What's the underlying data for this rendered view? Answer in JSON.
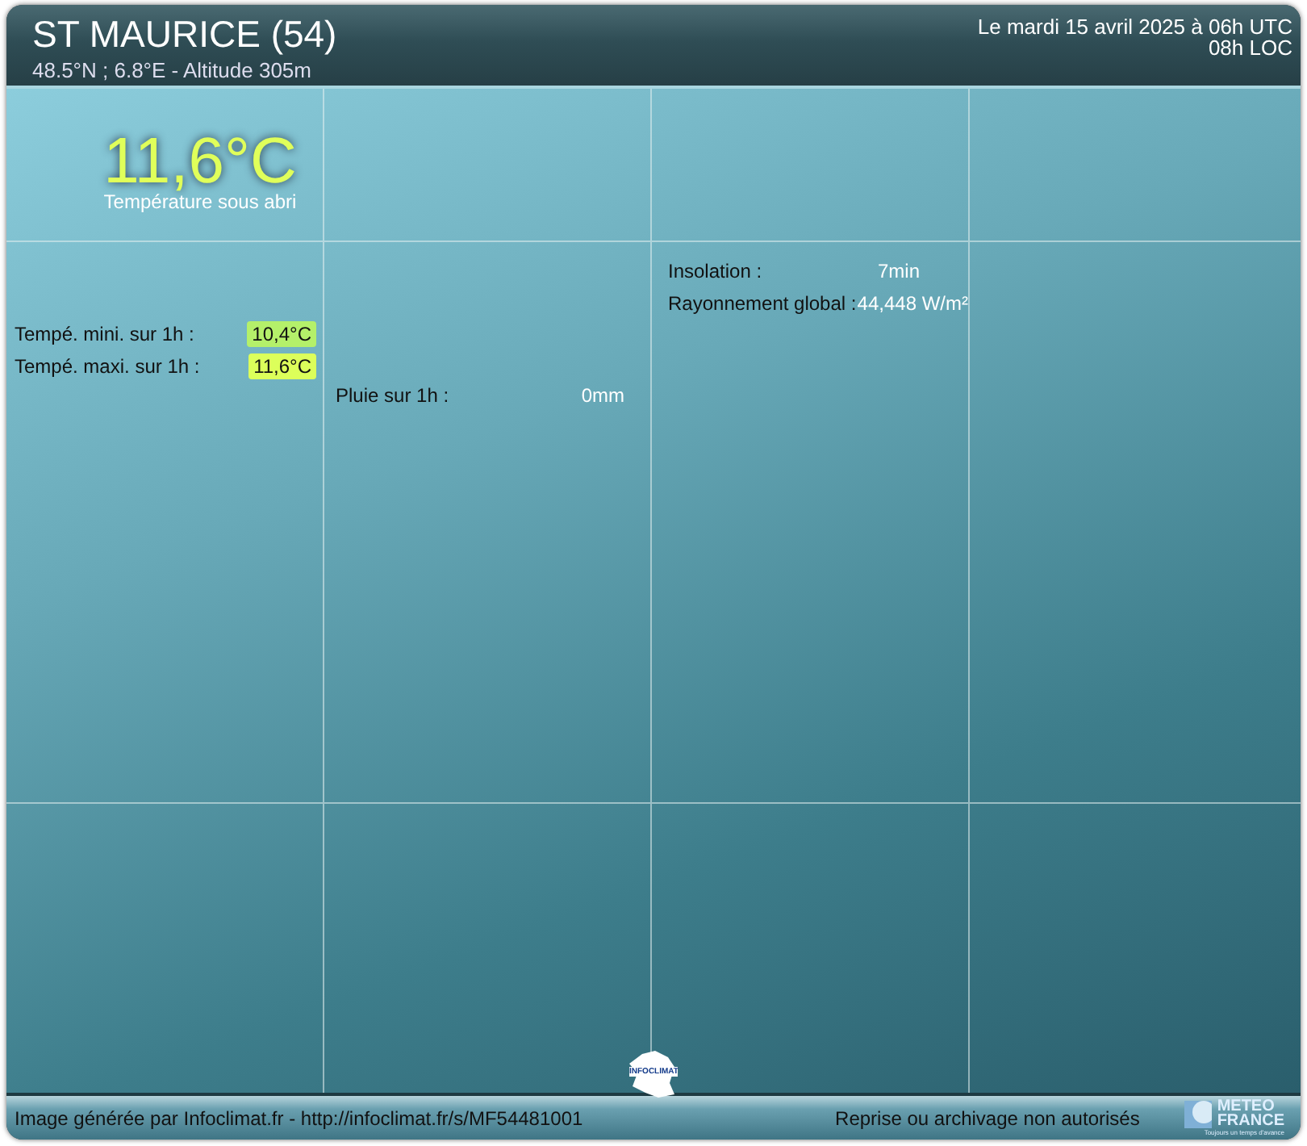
{
  "header": {
    "title": "ST MAURICE (54)",
    "subtitle": "48.5°N ; 6.8°E - Altitude 305m",
    "date": "Le mardi 15 avril 2025 à 06h UTC",
    "local_time": "08h LOC"
  },
  "temperature": {
    "value": "11,6°C",
    "label": "Température sous abri"
  },
  "extremes": [
    {
      "label": "Tempé. mini. sur 1h :",
      "value": "10,4°C",
      "color": "#b4f06a"
    },
    {
      "label": "Tempé. maxi. sur 1h :",
      "value": "11,6°C",
      "color": "#dcff5a"
    }
  ],
  "rain": {
    "label": "Pluie sur 1h :",
    "value": "0mm"
  },
  "sun": [
    {
      "label": "Insolation :",
      "value": "7min"
    },
    {
      "label": "Rayonnement global :",
      "value": "44,448 W/m²"
    }
  ],
  "footer": {
    "credit": "Image générée par Infoclimat.fr - http://infoclimat.fr/s/MF54481001",
    "notice": "Reprise ou archivage non autorisés",
    "infoclimat_logo": "INFOCLIMAT",
    "meteo_logo": [
      "METEO",
      "FRANCE"
    ],
    "meteo_tagline": "Toujours un temps d'avance"
  }
}
